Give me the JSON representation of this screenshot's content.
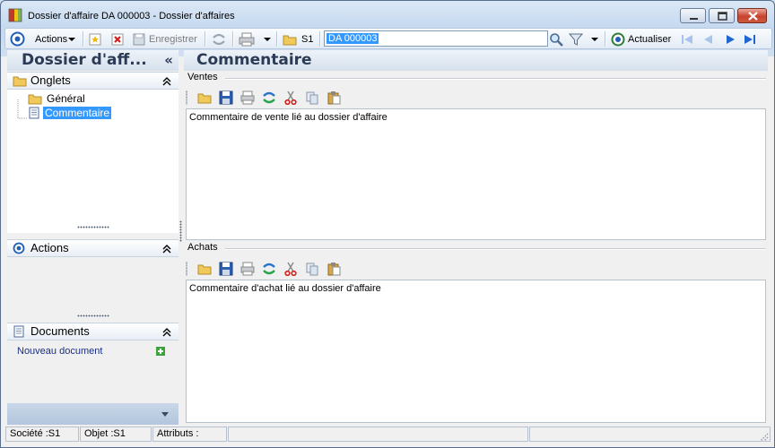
{
  "window": {
    "title": "Dossier d'affaire DA 000003 -  Dossier d'affaires"
  },
  "toolbar": {
    "actions_label": "Actions",
    "save_label": "Enregistrer",
    "company_label": "S1",
    "search_value": "DA 000003",
    "refresh_label": "Actualiser"
  },
  "left_panel": {
    "title": "Dossier d'aff...",
    "collapse_glyph": "«",
    "onglets": {
      "label": "Onglets",
      "items": [
        {
          "label": "Général",
          "icon": "folder-icon",
          "selected": false
        },
        {
          "label": "Commentaire",
          "icon": "document-icon",
          "selected": true
        }
      ]
    },
    "actions": {
      "label": "Actions"
    },
    "documents": {
      "label": "Documents",
      "new_document": "Nouveau document"
    }
  },
  "main": {
    "title": "Commentaire",
    "sales": {
      "label": "Ventes",
      "text": "Commentaire de vente lié au dossier d'affaire"
    },
    "purchases": {
      "label": "Achats",
      "text": "Commentaire d'achat lié au dossier d'affaire"
    }
  },
  "statusbar": {
    "company": "Société :S1",
    "object": "Objet :S1",
    "attributes": "Attributs :"
  },
  "colors": {
    "accent": "#3399ff",
    "title_text": "#2b3b55",
    "link": "#1a2e8a"
  }
}
